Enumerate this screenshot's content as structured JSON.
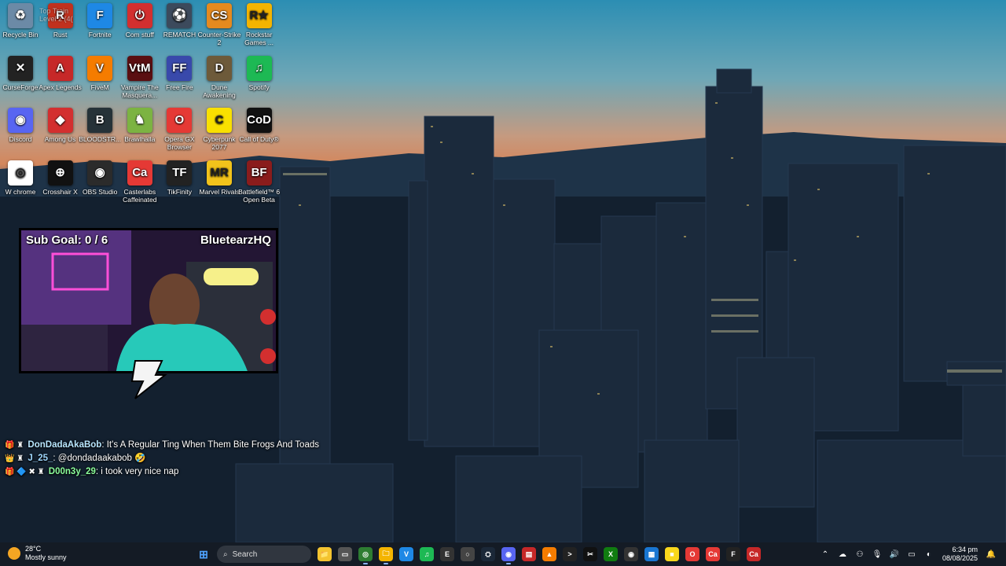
{
  "desktop_icons": [
    {
      "label": "Recycle Bin",
      "icon": "recycle-bin-icon",
      "color": "#6c8aa6"
    },
    {
      "label": "Rust",
      "icon": "rust-icon",
      "color": "#c1311e"
    },
    {
      "label": "Fortnite",
      "icon": "fortnite-icon",
      "color": "#1e88e5"
    },
    {
      "label": "Com stuff",
      "icon": "power-icon",
      "color": "#d32f2f"
    },
    {
      "label": "REMATCH",
      "icon": "rematch-icon",
      "color": "#3c4a5c"
    },
    {
      "label": "Counter-Strike 2",
      "icon": "counter-strike-icon",
      "color": "#e58a1f"
    },
    {
      "label": "Rockstar Games ...",
      "icon": "rockstar-icon",
      "color": "#f4b400"
    },
    {
      "label": "CurseForge",
      "icon": "curseforge-icon",
      "color": "#222222"
    },
    {
      "label": "Apex Legends",
      "icon": "apex-icon",
      "color": "#c62828"
    },
    {
      "label": "FiveM",
      "icon": "fivem-icon",
      "color": "#f57c00"
    },
    {
      "label": "Vampire The Masquera...",
      "icon": "vampire-icon",
      "color": "#5a0f12"
    },
    {
      "label": "Free Fire",
      "icon": "free-fire-icon",
      "color": "#3949ab"
    },
    {
      "label": "Dune Awakening",
      "icon": "dune-icon",
      "color": "#6d5a3a"
    },
    {
      "label": "Spotify",
      "icon": "spotify-icon",
      "color": "#1db954"
    },
    {
      "label": "Discord",
      "icon": "discord-icon",
      "color": "#5865f2"
    },
    {
      "label": "Among Us",
      "icon": "among-us-icon",
      "color": "#d32f2f"
    },
    {
      "label": "BLOODSTR...",
      "icon": "bloodstrike-icon",
      "color": "#263238"
    },
    {
      "label": "Brawlhalla",
      "icon": "brawlhalla-icon",
      "color": "#7cb342"
    },
    {
      "label": "Opera GX Browser",
      "icon": "opera-gx-icon",
      "color": "#e53935"
    },
    {
      "label": "Cyberpunk 2077",
      "icon": "cyberpunk-icon",
      "color": "#f9e000"
    },
    {
      "label": "Call of Duty®",
      "icon": "call-of-duty-icon",
      "color": "#111111"
    },
    {
      "label": "W chrome",
      "icon": "chrome-icon",
      "color": "#ffffff"
    },
    {
      "label": "Crosshair X",
      "icon": "crosshair-icon",
      "color": "#111111"
    },
    {
      "label": "OBS Studio",
      "icon": "obs-icon",
      "color": "#2b2b2b"
    },
    {
      "label": "Casterlabs Caffeinated",
      "icon": "casterlabs-icon",
      "color": "#e53935"
    },
    {
      "label": "TikFinity",
      "icon": "tikfinity-icon",
      "color": "#222222"
    },
    {
      "label": "Marvel Rivals",
      "icon": "marvel-rivals-icon",
      "color": "#f2c31b"
    },
    {
      "label": "Battlefield™ 6 Open Beta",
      "icon": "battlefield-icon",
      "color": "#8a1c1c"
    }
  ],
  "glyphs": [
    "♻",
    "R",
    "F",
    "⏻",
    "⚽",
    "CS",
    "R★",
    "✕",
    "A",
    "V",
    "VtM",
    "FF",
    "D",
    "♫",
    "◉",
    "◆",
    "B",
    "♞",
    "O",
    "C",
    "CoD",
    "◎",
    "⊕",
    "◉",
    "Ca",
    "TF",
    "MR",
    "BF"
  ],
  "overlay_text": "Top Train\nLevel 2 (4(",
  "webcam": {
    "sub_goal": "Sub Goal:  0 / 6",
    "channel_name": "BluetearzHQ"
  },
  "chat": [
    {
      "badges": "🎁 ♜",
      "username": "DonDadaAkaBob",
      "separator": ": ",
      "message": "It's A Regular Ting When Them Bite Frogs And Toads"
    },
    {
      "badges": "👑 ♜",
      "username": "J_25_",
      "separator": ": ",
      "message": "@dondadaakabob 🤣"
    },
    {
      "badges": "🎁 🔷 ✖ ♜",
      "username": "D00n3y_29",
      "separator": ": ",
      "message": "i took very nice nap"
    }
  ],
  "taskbar": {
    "weather": {
      "temp": "28°C",
      "condition": "Mostly sunny"
    },
    "search_placeholder": "Search",
    "clock": {
      "time": "6:34 pm",
      "date": "08/08/2025"
    },
    "pinned": [
      {
        "name": "file-explorer-icon",
        "glyph": "📁",
        "color": "#f4c430"
      },
      {
        "name": "task-view-icon",
        "glyph": "▭",
        "color": "#555555"
      },
      {
        "name": "chrome-icon",
        "glyph": "◎",
        "color": "#2e7d32"
      },
      {
        "name": "folder-icon",
        "glyph": "🗀",
        "color": "#f4b400"
      },
      {
        "name": "vscode-icon",
        "glyph": "V",
        "color": "#1e88e5"
      },
      {
        "name": "spotify-icon",
        "glyph": "♫",
        "color": "#1db954"
      },
      {
        "name": "epic-games-icon",
        "glyph": "E",
        "color": "#333333"
      },
      {
        "name": "circle-app-icon",
        "glyph": "○",
        "color": "#444444"
      },
      {
        "name": "steam-icon",
        "glyph": "⛭",
        "color": "#1b2838"
      },
      {
        "name": "discord-icon",
        "glyph": "◉",
        "color": "#5865f2"
      },
      {
        "name": "notepad-icon",
        "glyph": "▤",
        "color": "#c62828"
      },
      {
        "name": "vlc-icon",
        "glyph": "▲",
        "color": "#f57c00"
      },
      {
        "name": "terminal-icon",
        "glyph": ">",
        "color": "#222222"
      },
      {
        "name": "capcut-icon",
        "glyph": "✂",
        "color": "#111111"
      },
      {
        "name": "xbox-icon",
        "glyph": "X",
        "color": "#107c10"
      },
      {
        "name": "obs-icon",
        "glyph": "◉",
        "color": "#333333"
      },
      {
        "name": "photos-icon",
        "glyph": "▦",
        "color": "#1976d2"
      },
      {
        "name": "sticky-notes-icon",
        "glyph": "■",
        "color": "#f9d71c"
      },
      {
        "name": "opera-gx-icon",
        "glyph": "O",
        "color": "#e53935"
      },
      {
        "name": "casterlabs-icon",
        "glyph": "Ca",
        "color": "#e53935"
      },
      {
        "name": "tikfinity-icon",
        "glyph": "F",
        "color": "#222222"
      },
      {
        "name": "casterlabs-2-icon",
        "glyph": "Ca",
        "color": "#c62828"
      }
    ],
    "tray": [
      "chevron-up-icon",
      "onedrive-icon",
      "network-icon",
      "microphone-icon",
      "speaker-icon",
      "battery-icon",
      "notification-icon"
    ],
    "tray_glyphs": [
      "⌃",
      "☁",
      "⚇",
      "🎙",
      "🔊",
      "▭",
      "◐"
    ]
  }
}
